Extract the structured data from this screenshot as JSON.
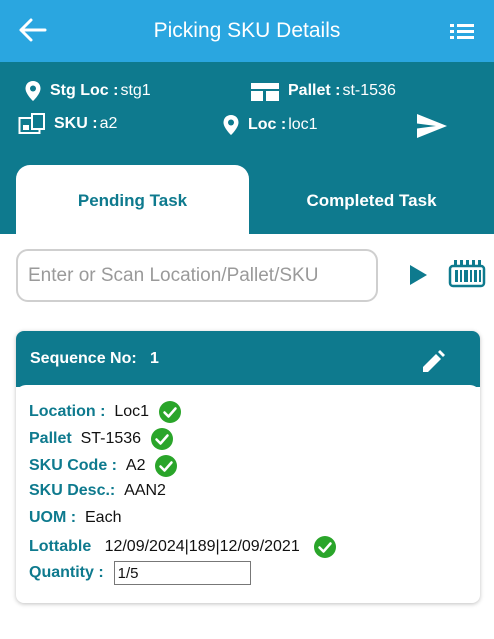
{
  "appbar": {
    "title": "Picking SKU Details",
    "back_icon": "arrow-left-icon",
    "menu_icon": "list-icon"
  },
  "info": {
    "stg_loc_label": "Stg Loc :",
    "stg_loc_value": "stg1",
    "pallet_label": "Pallet :",
    "pallet_value": "st-1536",
    "sku_label": "SKU :",
    "sku_value": "a2",
    "loc_label": "Loc :",
    "loc_value": "loc1"
  },
  "tabs": {
    "pending": "Pending Task",
    "completed": "Completed Task"
  },
  "search": {
    "placeholder": "Enter or Scan Location/Pallet/SKU",
    "value": ""
  },
  "card": {
    "sequence_label": "Sequence No:",
    "sequence_value": "1",
    "fields": {
      "location_label": "Location :",
      "location_value": "Loc1",
      "pallet_label": "Pallet",
      "pallet_value": "ST-1536",
      "sku_code_label": "SKU Code :",
      "sku_code_value": "A2",
      "sku_desc_label": "SKU Desc.:",
      "sku_desc_value": "AAN2",
      "uom_label": "UOM :",
      "uom_value": "Each",
      "lottable_label": "Lottable",
      "lottable_value": "12/09/2024|189|12/09/2021",
      "quantity_label": "Quantity :",
      "quantity_value": "1/5"
    }
  },
  "colors": {
    "appbar": "#2aa6e0",
    "header": "#0e7a8e",
    "check": "#2aa52a"
  }
}
